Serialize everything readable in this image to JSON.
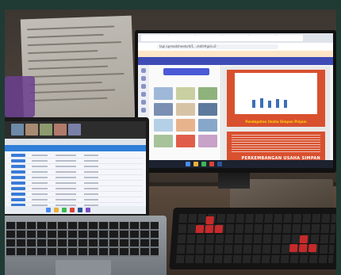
{
  "scene": {
    "monitor": {
      "address_bar": "lapi.spreadsheets/d/1…/edit#gid=0",
      "slide_caption": "Pendapatan Usaha Simpan Pinjam",
      "slide_heading": "PERKEMBANGAN USAHA SIMPAN"
    },
    "colors": {
      "slide_red": "#d9502f",
      "app_bar": "#3f4bb5",
      "caption_yellow": "#ffd400",
      "keyboard_accent": "#c62a2a"
    }
  }
}
